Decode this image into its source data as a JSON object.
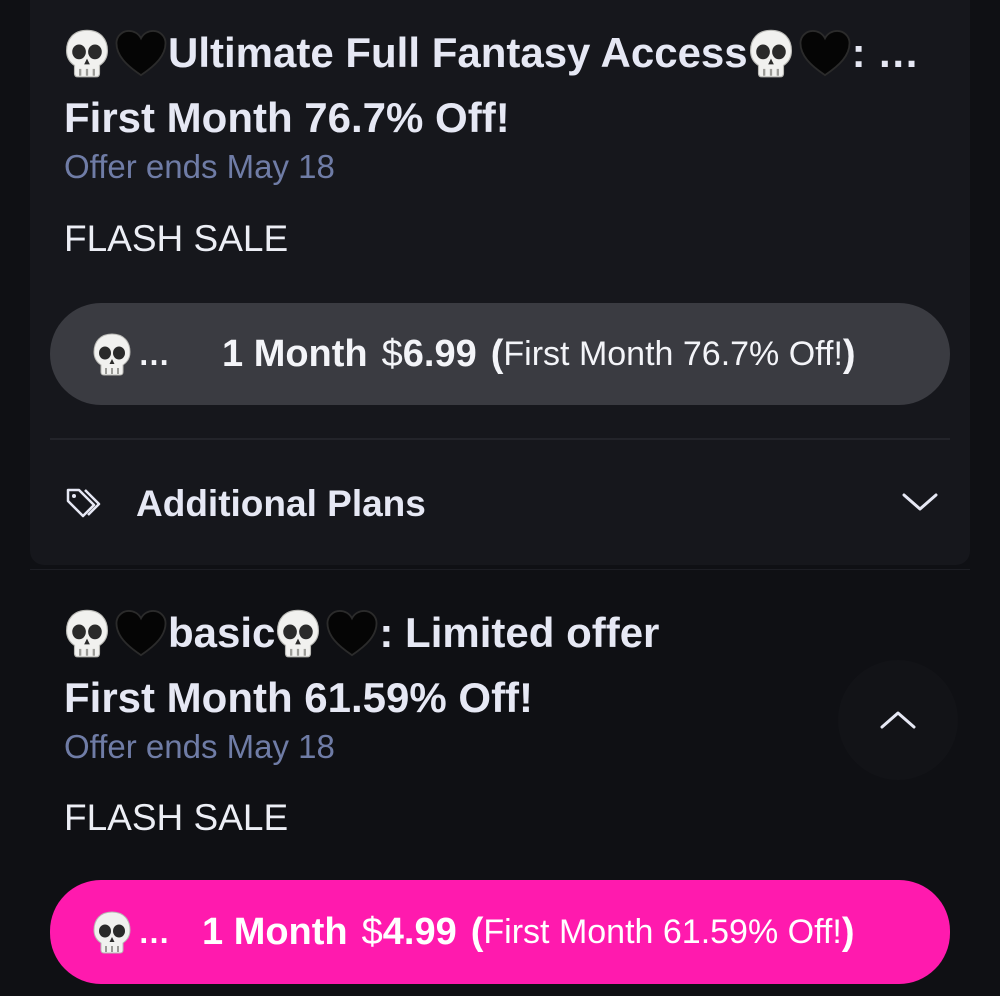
{
  "colors": {
    "background": "#0f1014",
    "card": "#16171c",
    "offer_text": "#6f7ca6",
    "plan_gray": "#3a3b41",
    "plan_pink": "#ff1aae"
  },
  "bundle1": {
    "title_prefix_icons": [
      "skull-icon",
      "black-heart-icon"
    ],
    "title_name": "Ultimate Full Fantasy Access",
    "title_suffix_icons": [
      "skull-icon",
      "black-heart-icon"
    ],
    "title_after": ": …",
    "subtitle": "First Month 76.7% Off!",
    "offer_ends": "Offer ends May 18",
    "sale_label": "FLASH SALE",
    "plan": {
      "ellipsis": "…",
      "duration": "1 Month",
      "currency": "$",
      "amount": "6.99",
      "open_paren": "(",
      "note": "First Month 76.7% Off!",
      "close_paren": ")"
    },
    "additional_plans": "Additional Plans"
  },
  "bundle2": {
    "title_prefix_icons": [
      "skull-icon",
      "black-heart-icon"
    ],
    "title_name": "basic",
    "title_suffix_icons": [
      "skull-icon",
      "black-heart-icon"
    ],
    "title_after": ": Limited offer",
    "subtitle": "First Month 61.59% Off!",
    "offer_ends": "Offer ends May 18",
    "sale_label": "FLASH SALE",
    "plan": {
      "ellipsis": "…",
      "duration": "1 Month",
      "currency": "$",
      "amount": "4.99",
      "open_paren": "(",
      "note": "First Month 61.59% Off!",
      "close_paren": ")"
    }
  }
}
